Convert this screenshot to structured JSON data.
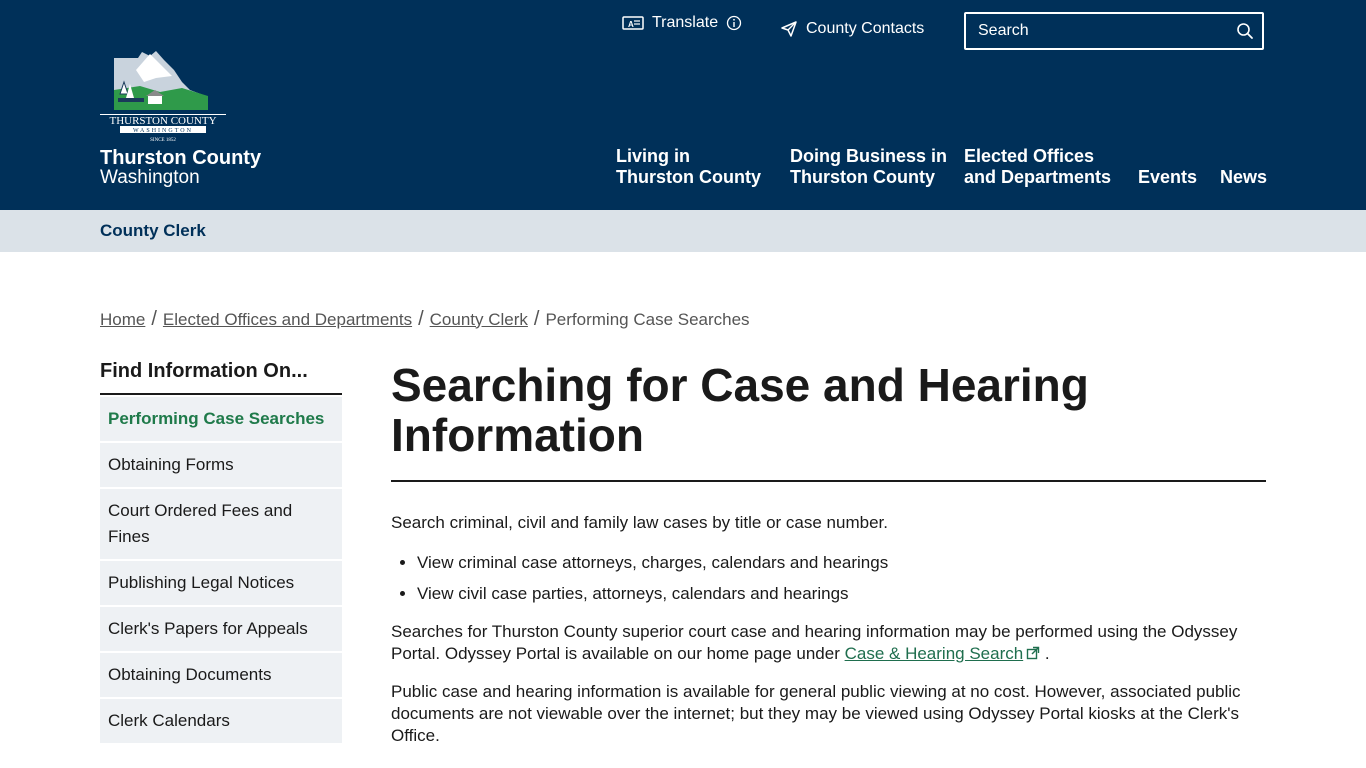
{
  "header": {
    "county_name": "Thurston County",
    "state": "Washington",
    "logo_text": "THURSTON COUNTY",
    "logo_sub": "WASHINGTON",
    "logo_since": "SINCE 1852",
    "translate_label": "Translate",
    "contacts_label": "County Contacts",
    "search_placeholder": "Search",
    "nav": [
      {
        "line1": "Living in",
        "line2": "Thurston County"
      },
      {
        "line1": "Doing Business in",
        "line2": "Thurston County"
      },
      {
        "line1": "Elected Offices",
        "line2": "and Departments"
      },
      {
        "label": "Events"
      },
      {
        "label": "News"
      }
    ],
    "colors": {
      "header_bg": "#003059",
      "subbar_bg": "#dbe2e8",
      "accent_green": "#1f7a4a"
    }
  },
  "subbar": {
    "title": "County Clerk"
  },
  "breadcrumb": {
    "items": [
      "Home",
      "Elected Offices and Departments",
      "County Clerk"
    ],
    "current": "Performing Case Searches",
    "separator": "/"
  },
  "sidebar": {
    "heading": "Find Information On...",
    "items": [
      {
        "label": "Performing Case Searches"
      },
      {
        "label": "Obtaining Forms"
      },
      {
        "label": "Court Ordered Fees and Fines"
      },
      {
        "label": "Publishing Legal Notices"
      },
      {
        "label": "Clerk's Papers for Appeals"
      },
      {
        "label": "Obtaining Documents"
      },
      {
        "label": "Clerk Calendars"
      }
    ]
  },
  "main": {
    "title": "Searching for Case and Hearing Information",
    "intro": "Search criminal, civil and family law cases by title or case number.",
    "bullets": [
      "View criminal case attorneys, charges,  calendars and hearings",
      "View civil case parties, attorneys, calendars and hearings"
    ],
    "para1_before": "Searches for Thurston County superior court case and hearing information may be performed using the Odyssey Portal. Odyssey Portal is available on our home page under ",
    "para1_link": "Case & Hearing Search",
    "para1_after": " .",
    "para2": "Public case and hearing information is available for general public viewing at no cost. However, associated public documents are not viewable over the internet; but they may be viewed using Odyssey Portal kiosks at the Clerk's Office."
  }
}
